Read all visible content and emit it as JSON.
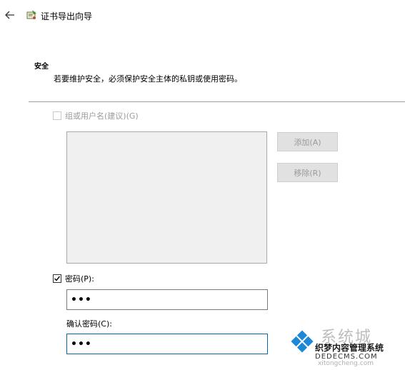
{
  "header": {
    "back_icon": "arrow-left-icon",
    "wizard_icon": "certificate-wizard-icon",
    "title": "证书导出向导"
  },
  "security": {
    "title": "安全",
    "description": "若要维护安全，必须保护安全主体的私钥或使用密码。"
  },
  "group_user": {
    "label": "组或用户名(建议)(G)",
    "checked": false,
    "enabled": false,
    "add_label": "添加(A)",
    "remove_label": "移除(R)",
    "items": []
  },
  "password": {
    "label": "密码(P):",
    "checked": true,
    "value": "•••",
    "confirm_label": "确认密码(C):",
    "confirm_value": "•••"
  },
  "watermark": {
    "big": "系统城",
    "mid": "织梦内容管理系统",
    "small": "DEDECMS.COM",
    "url": "xitongcheng.com"
  },
  "colors": {
    "focus_border": "#0a64a8",
    "disabled_text": "#9a9a9a",
    "list_bg": "#f0f0f0"
  }
}
